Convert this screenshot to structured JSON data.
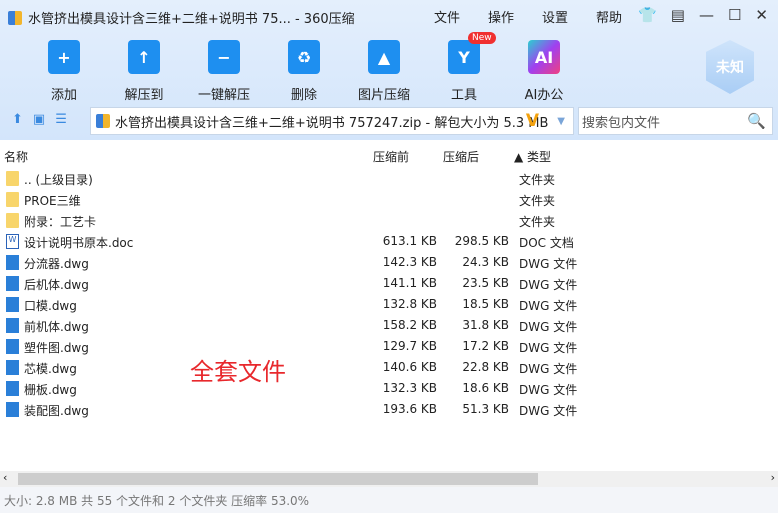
{
  "window": {
    "title": "水管挤出模具设计含三维+二维+说明书 75... - 360压缩",
    "menu": [
      "文件",
      "操作",
      "设置",
      "帮助"
    ]
  },
  "toolbar": [
    {
      "label": "添加",
      "icon": "add-icon"
    },
    {
      "label": "解压到",
      "icon": "extract-icon"
    },
    {
      "label": "一键解压",
      "icon": "one-click-extract-icon"
    },
    {
      "label": "删除",
      "icon": "delete-icon"
    },
    {
      "label": "图片压缩",
      "icon": "image-compress-icon"
    },
    {
      "label": "工具",
      "icon": "tools-icon",
      "badge": "New"
    },
    {
      "label": "AI办公",
      "icon": "ai-icon"
    }
  ],
  "security_badge": "未知",
  "address": "水管挤出模具设计含三维+二维+说明书 757247.zip - 解包大小为 5.3 MB",
  "search": {
    "placeholder": "搜索包内文件"
  },
  "columns": {
    "name": "名称",
    "packed": "压缩前",
    "compressed": "压缩后",
    "type": "▲ 类型"
  },
  "files": [
    {
      "name": ".. (上级目录)",
      "size": "",
      "packed": "",
      "type": "文件夹",
      "kind": "folder"
    },
    {
      "name": "PROE三维",
      "size": "",
      "packed": "",
      "type": "文件夹",
      "kind": "folder"
    },
    {
      "name": "附录：工艺卡",
      "size": "",
      "packed": "",
      "type": "文件夹",
      "kind": "folder"
    },
    {
      "name": "设计说明书原本.doc",
      "size": "613.1 KB",
      "packed": "298.5 KB",
      "type": "DOC 文档",
      "kind": "doc"
    },
    {
      "name": "分流器.dwg",
      "size": "142.3 KB",
      "packed": "24.3 KB",
      "type": "DWG 文件",
      "kind": "dwg"
    },
    {
      "name": "后机体.dwg",
      "size": "141.1 KB",
      "packed": "23.5 KB",
      "type": "DWG 文件",
      "kind": "dwg"
    },
    {
      "name": "口模.dwg",
      "size": "132.8 KB",
      "packed": "18.5 KB",
      "type": "DWG 文件",
      "kind": "dwg"
    },
    {
      "name": "前机体.dwg",
      "size": "158.2 KB",
      "packed": "31.8 KB",
      "type": "DWG 文件",
      "kind": "dwg"
    },
    {
      "name": "塑件图.dwg",
      "size": "129.7 KB",
      "packed": "17.2 KB",
      "type": "DWG 文件",
      "kind": "dwg"
    },
    {
      "name": "芯模.dwg",
      "size": "140.6 KB",
      "packed": "22.8 KB",
      "type": "DWG 文件",
      "kind": "dwg"
    },
    {
      "name": "栅板.dwg",
      "size": "132.3 KB",
      "packed": "18.6 KB",
      "type": "DWG 文件",
      "kind": "dwg"
    },
    {
      "name": "装配图.dwg",
      "size": "193.6 KB",
      "packed": "51.3 KB",
      "type": "DWG 文件",
      "kind": "dwg"
    }
  ],
  "watermark": "全套文件",
  "status": "大小: 2.8 MB 共 55 个文件和 2 个文件夹 压缩率 53.0%"
}
